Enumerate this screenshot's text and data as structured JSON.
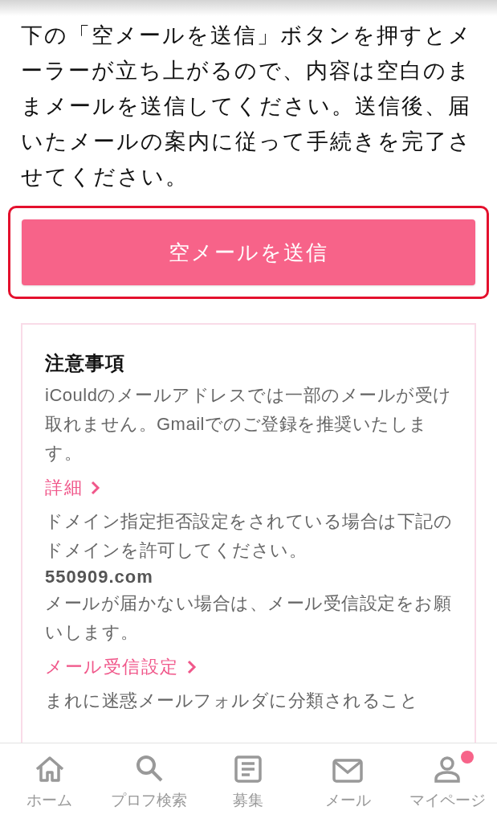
{
  "intro": "下の「空メールを送信」ボタンを押すとメーラーが立ち上がるので、内容は空白のままメールを送信してください。送信後、届いたメールの案内に従って手続きを完了させてください。",
  "send_button": {
    "label": "空メールを送信",
    "highlighted": true
  },
  "notice": {
    "title": "注意事項",
    "blocks": [
      {
        "kind": "text",
        "text": "iCouldのメールアドレスでは一部のメールが受け取れません。Gmailでのご登録を推奨いたします。"
      },
      {
        "kind": "link",
        "text": "詳細"
      },
      {
        "kind": "text",
        "text": "ドメイン指定拒否設定をされている場合は下記のドメインを許可してください。"
      },
      {
        "kind": "bold",
        "text": "550909.com"
      },
      {
        "kind": "text",
        "text": "メールが届かない場合は、メール受信設定をお願いします。"
      },
      {
        "kind": "link",
        "text": "メール受信設定"
      },
      {
        "kind": "text",
        "text": "まれに迷惑メールフォルダに分類されること"
      }
    ]
  },
  "nav": [
    {
      "label": "ホーム",
      "badge": false
    },
    {
      "label": "プロフ検索",
      "badge": false
    },
    {
      "label": "募集",
      "badge": false
    },
    {
      "label": "メール",
      "badge": false
    },
    {
      "label": "マイページ",
      "badge": true
    }
  ]
}
